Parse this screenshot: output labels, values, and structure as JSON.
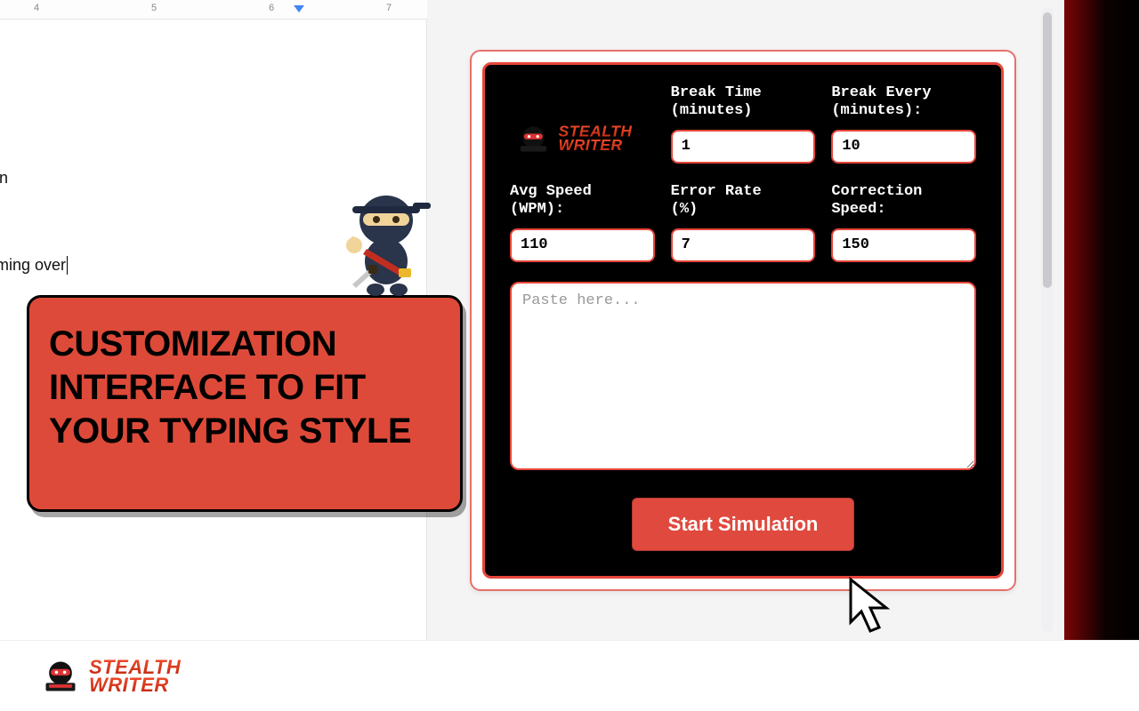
{
  "ruler": {
    "marks": [
      "4",
      "5",
      "6",
      "7"
    ]
  },
  "document": {
    "line1": "nation",
    "line2": "r looming over"
  },
  "callout": "CUSTOMIZATION INTERFACE TO FIT YOUR TYPING STYLE",
  "panel": {
    "brand1": "STEALTH",
    "brand2": "WRITER",
    "labels": {
      "break_time": "Break Time\n(minutes)",
      "break_every": "Break Every\n(minutes):",
      "avg_speed": "Avg Speed\n(WPM):",
      "error_rate": "Error Rate\n(%)",
      "correction_speed": "Correction\nSpeed:"
    },
    "values": {
      "break_time": "1",
      "break_every": "10",
      "avg_speed": "110",
      "error_rate": "7",
      "correction_speed": "150"
    },
    "paste_placeholder": "Paste here...",
    "start_label": "Start Simulation"
  },
  "footer": {
    "brand1": "STEALTH",
    "brand2": "WRITER"
  }
}
